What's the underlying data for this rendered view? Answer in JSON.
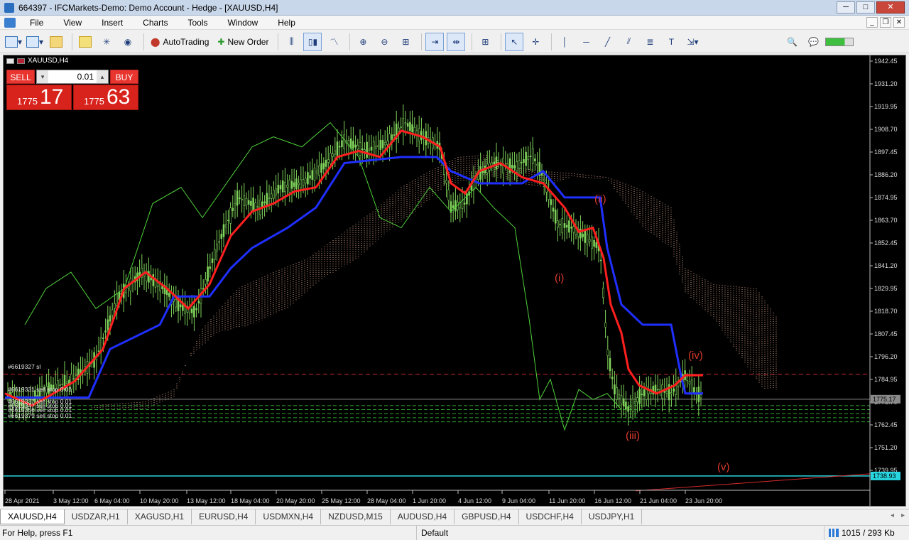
{
  "window": {
    "title": "664397 - IFCMarkets-Demo: Demo Account - Hedge - [XAUUSD,H4]",
    "minimize": "─",
    "maximize": "□",
    "close": "✕"
  },
  "menu": [
    "File",
    "Insert",
    "Charts",
    "Tools",
    "Window",
    "Help"
  ],
  "menu_view": "View",
  "toolbar": {
    "autotrading": "AutoTrading",
    "new_order": "New Order"
  },
  "chart": {
    "symbol": "XAUUSD,H4",
    "trade": {
      "sell": "SELL",
      "buy": "BUY",
      "lot": "0.01",
      "sell_small": "1775",
      "sell_big": "17",
      "buy_small": "1775",
      "buy_big": "63"
    },
    "price_axis": [
      "1942.45",
      "1931.20",
      "1919.95",
      "1908.70",
      "1897.45",
      "1886.20",
      "1874.95",
      "1863.70",
      "1852.45",
      "1841.20",
      "1829.95",
      "1818.70",
      "1807.45",
      "1796.20",
      "1784.95",
      "1773.70",
      "1762.45",
      "1751.20",
      "1739.95"
    ],
    "price_marker_bid": "1775.17",
    "price_marker_line": "1738.93",
    "time_axis": [
      "28 Apr 2021",
      "3 May 12:00",
      "6 May 04:00",
      "10 May 20:00",
      "13 May 12:00",
      "18 May 04:00",
      "20 May 20:00",
      "25 May 12:00",
      "28 May 04:00",
      "1 Jun 20:00",
      "4 Jun 12:00",
      "9 Jun 04:00",
      "11 Jun 20:00",
      "16 Jun 12:00",
      "21 Jun 04:00",
      "23 Jun 20:00"
    ],
    "order_labels": [
      "#6619327 sl",
      "#6619331 sell stop 0.01",
      "#6619337 sell stop 0.01",
      "#6619347 sell stop 0.01",
      "#6619356 sell stop 0.01",
      "#6619379 sell stop 0.01"
    ],
    "wave_labels": {
      "i": "(i)",
      "ii": "(ii)",
      "iii": "(iii)",
      "iv": "(iv)",
      "v": "(v)"
    },
    "colors": {
      "background": "#000000",
      "candles": "#7fd35a",
      "tenkan": "#ff1f1f",
      "kijun": "#1f2fff",
      "chikou": "#4fd23a",
      "cloud": "#d9a489",
      "wave_text": "#e03a2e",
      "bid_line": "#8a8a8a",
      "hline": "#27d6e0"
    }
  },
  "tabs": [
    "XAUUSD,H4",
    "USDZAR,H1",
    "XAGUSD,H1",
    "EURUSD,H4",
    "USDMXN,H4",
    "NZDUSD,M15",
    "AUDUSD,H4",
    "GBPUSD,H4",
    "USDCHF,H4",
    "USDJPY,H1"
  ],
  "status": {
    "help": "For Help, press F1",
    "profile": "Default",
    "traffic": "1015 / 293 Kb"
  }
}
